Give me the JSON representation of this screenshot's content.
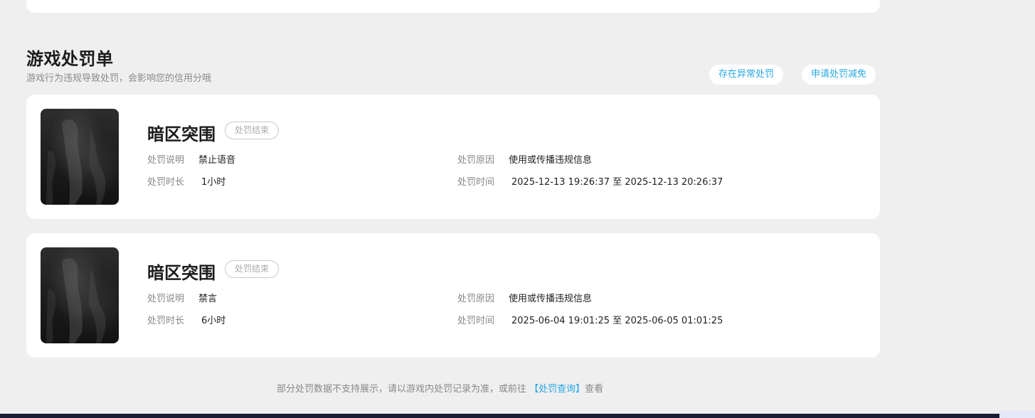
{
  "section": {
    "title": "游戏处罚单",
    "subtitle": "游戏行为违规导致处罚，会影响您的信用分哦"
  },
  "actions": {
    "anomaly_label": "存在异常处罚",
    "reduce_label": "申请处罚减免"
  },
  "labels": {
    "description": "处罚说明",
    "duration": "处罚时长",
    "reason": "处罚原因",
    "time": "处罚时间"
  },
  "records": [
    {
      "game": "暗区突围",
      "status": "处罚结束",
      "description": "禁止语音",
      "duration": "1小时",
      "reason": "使用或传播违规信息",
      "time": "2025-12-13 19:26:37 至 2025-12-13 20:26:37"
    },
    {
      "game": "暗区突围",
      "status": "处罚结束",
      "description": "禁言",
      "duration": "6小时",
      "reason": "使用或传播违规信息",
      "time": "2025-06-04 19:01:25 至 2025-06-05 01:01:25"
    }
  ],
  "footer": {
    "text_before": "部分处罚数据不支持展示，请以游戏内处罚记录为准，或前往",
    "link": "【处罚查询】",
    "text_after": "查看"
  }
}
